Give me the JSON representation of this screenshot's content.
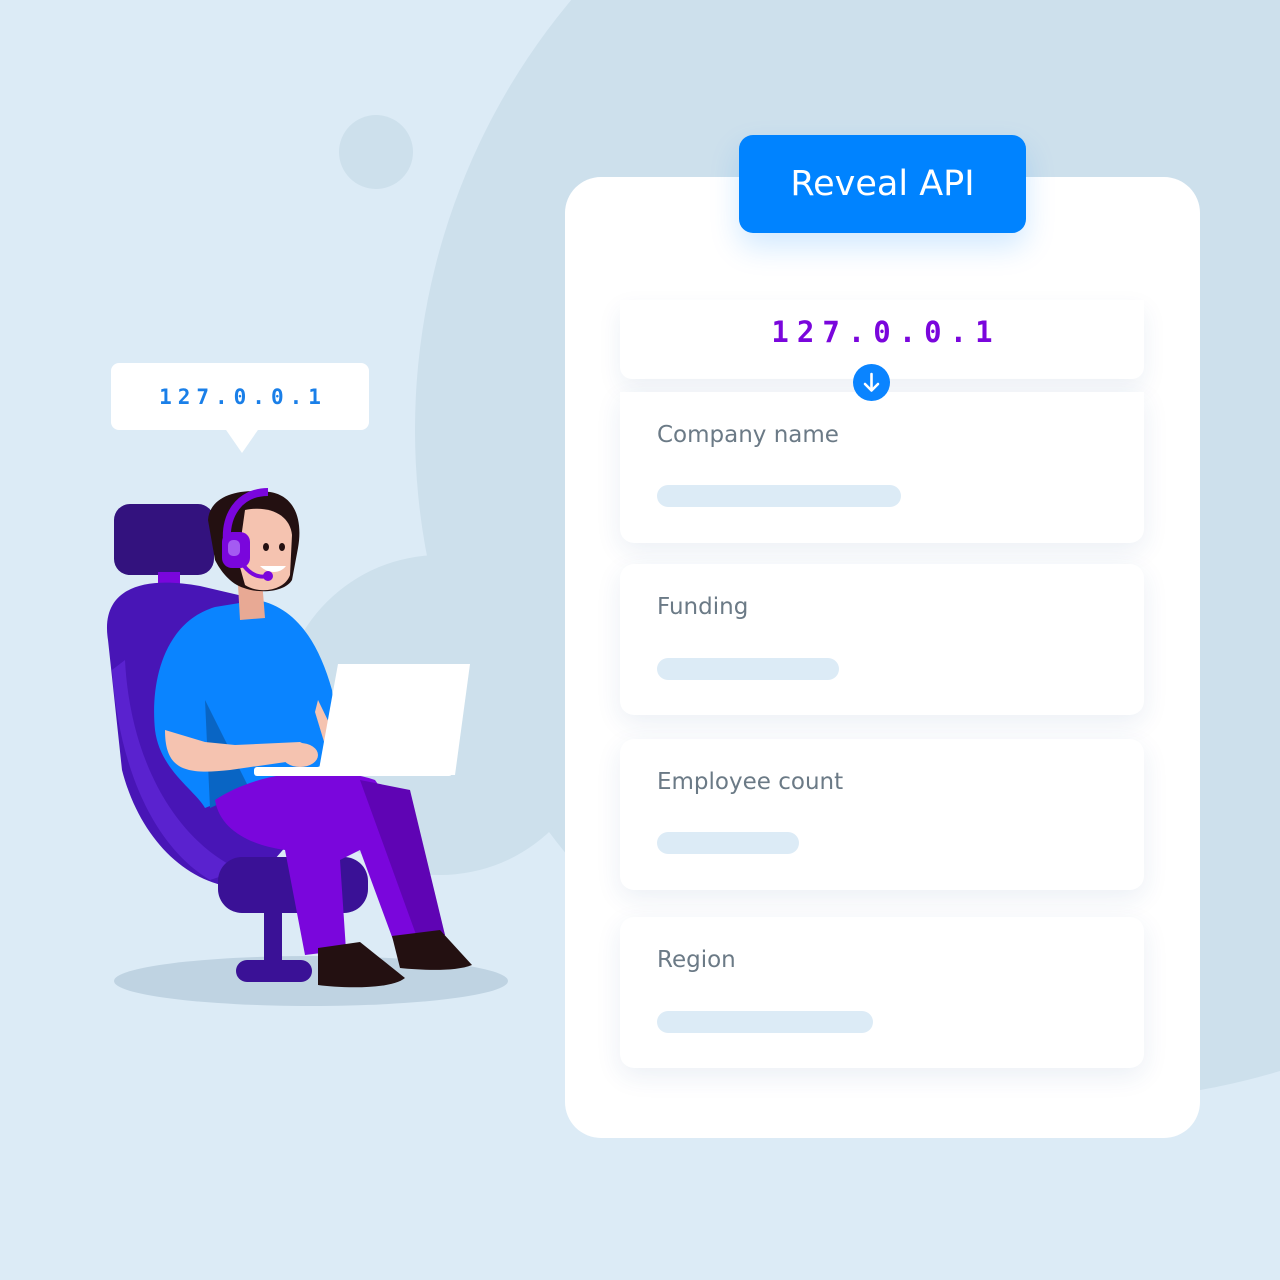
{
  "header": {
    "button_label": "Reveal API"
  },
  "speech_bubble": {
    "ip": "127.0.0.1"
  },
  "card": {
    "ip": "127.0.0.1",
    "fields": [
      {
        "label": "Company name"
      },
      {
        "label": "Funding"
      },
      {
        "label": "Employee count"
      },
      {
        "label": "Region"
      }
    ]
  },
  "icons": {
    "arrow": "arrow-down-icon",
    "character": "person-with-headset-icon",
    "laptop": "laptop-icon",
    "chair": "office-chair-icon"
  },
  "colors": {
    "background": "#dcebf6",
    "accent_blue": "#0083ff",
    "ip_purple": "#7a06dc",
    "label_gray": "#6b7a86"
  }
}
